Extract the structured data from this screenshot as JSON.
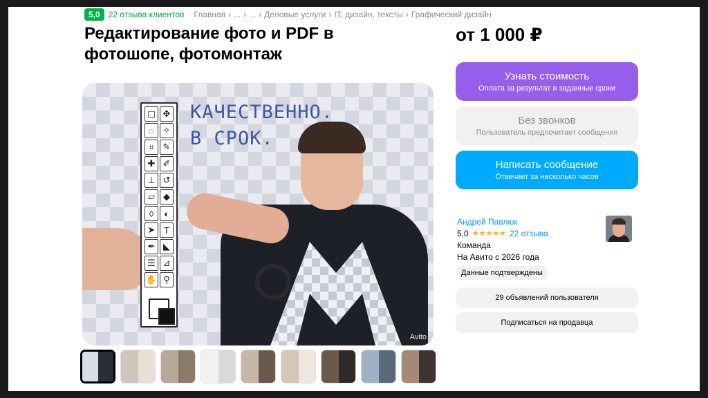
{
  "header": {
    "rating": "5,0",
    "reviews_link": "22 отзыва клиентов",
    "breadcrumbs": [
      "Главная",
      "...",
      "...",
      "Деловые услуги",
      "IT, дизайн, тексты",
      "Графический дизайн"
    ],
    "separator": "›"
  },
  "listing": {
    "title": "Редактирование фото и PDF в фотошопе, фотомонтаж",
    "price": "от 1 000 ₽"
  },
  "hero": {
    "text_line1": "КАЧЕСТВЕННО.",
    "text_line2": "В СРОК.",
    "watermark": "Avito"
  },
  "thumbnails": [
    {
      "active": true,
      "c1": "#d9dde6",
      "c2": "#2a2e36"
    },
    {
      "active": false,
      "c1": "#cfc6bc",
      "c2": "#e8e0d6"
    },
    {
      "active": false,
      "c1": "#b9a89a",
      "c2": "#8a7a6c"
    },
    {
      "active": false,
      "c1": "#f1f1f1",
      "c2": "#d9d9d9"
    },
    {
      "active": false,
      "c1": "#c8b6a6",
      "c2": "#6a5a4e"
    },
    {
      "active": false,
      "c1": "#d5c7b8",
      "c2": "#efe7df"
    },
    {
      "active": false,
      "c1": "#6b5a4c",
      "c2": "#2e2a28"
    },
    {
      "active": false,
      "c1": "#9fb2c4",
      "c2": "#5b6a7a"
    },
    {
      "active": false,
      "c1": "#a48a72",
      "c2": "#3e3530"
    }
  ],
  "actions": {
    "cost_main": "Узнать стоимость",
    "cost_sub": "Оплата за результат в заданные сроки",
    "nocalls_main": "Без звонков",
    "nocalls_sub": "Пользователь предпочитает сообщения",
    "message_main": "Написать сообщение",
    "message_sub": "Отвечает за несколько часов"
  },
  "seller": {
    "name": "Андрей Павлюк",
    "rating": "5,0",
    "stars": "★★★★★",
    "reviews": "22 отзыва",
    "type": "Команда",
    "since": "На Авито с 2026 года",
    "verified": "Данные подтверждены",
    "ads_count": "29 объявлений пользователя",
    "subscribe": "Подписаться на продавца"
  },
  "colors": {
    "rating_green": "#02b34b",
    "purple": "#965eeb",
    "blue": "#00aaff",
    "link_blue": "#0099f7",
    "star_orange": "#ffb021"
  }
}
